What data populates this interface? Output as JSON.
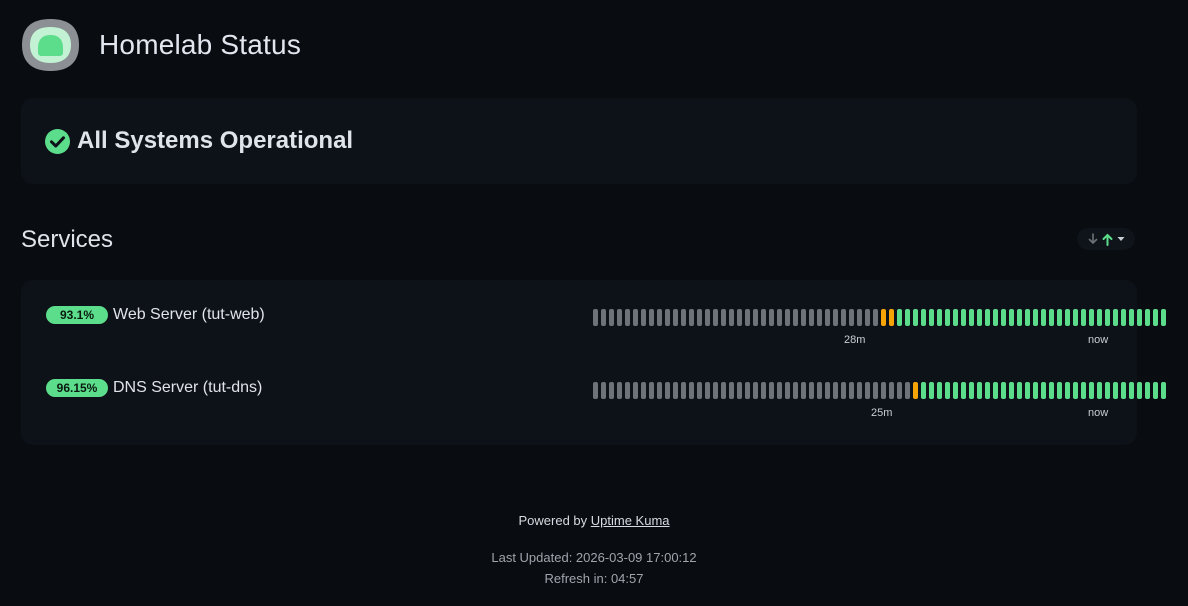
{
  "page": {
    "title": "Homelab Status",
    "logo_icon": "uptime-kuma-logo-icon"
  },
  "overall": {
    "status_text": "All Systems Operational",
    "icon": "check-circle-icon",
    "color": "#5cdd8b"
  },
  "services_section": {
    "title": "Services",
    "sort_icons": [
      "arrow-down-icon",
      "arrow-up-icon",
      "caret-down-icon"
    ]
  },
  "services": [
    {
      "name": "Web Server (tut-web)",
      "uptime": "93.1%",
      "beats": [
        "down",
        "down",
        "down",
        "down",
        "down",
        "down",
        "down",
        "down",
        "down",
        "down",
        "down",
        "down",
        "down",
        "down",
        "down",
        "down",
        "down",
        "down",
        "down",
        "down",
        "down",
        "down",
        "down",
        "down",
        "down",
        "down",
        "down",
        "down",
        "down",
        "down",
        "down",
        "down",
        "down",
        "down",
        "down",
        "down",
        "pending",
        "pending",
        "up",
        "up",
        "up",
        "up",
        "up",
        "up",
        "up",
        "up",
        "up",
        "up",
        "up",
        "up",
        "up",
        "up",
        "up",
        "up",
        "up",
        "up",
        "up",
        "up",
        "up",
        "up",
        "up",
        "up",
        "up",
        "up",
        "up",
        "up",
        "up",
        "up",
        "up",
        "up",
        "up",
        "up"
      ],
      "since_label": "28m",
      "now_label": "now"
    },
    {
      "name": "DNS Server (tut-dns)",
      "uptime": "96.15%",
      "beats": [
        "down",
        "down",
        "down",
        "down",
        "down",
        "down",
        "down",
        "down",
        "down",
        "down",
        "down",
        "down",
        "down",
        "down",
        "down",
        "down",
        "down",
        "down",
        "down",
        "down",
        "down",
        "down",
        "down",
        "down",
        "down",
        "down",
        "down",
        "down",
        "down",
        "down",
        "down",
        "down",
        "down",
        "down",
        "down",
        "down",
        "down",
        "down",
        "down",
        "down",
        "pending",
        "up",
        "up",
        "up",
        "up",
        "up",
        "up",
        "up",
        "up",
        "up",
        "up",
        "up",
        "up",
        "up",
        "up",
        "up",
        "up",
        "up",
        "up",
        "up",
        "up",
        "up",
        "up",
        "up",
        "up",
        "up",
        "up",
        "up",
        "up",
        "up",
        "up",
        "up"
      ],
      "since_label": "25m",
      "now_label": "now"
    }
  ],
  "footer": {
    "powered_prefix": "Powered by",
    "powered_link": "Uptime Kuma",
    "last_updated": "Last Updated: 2026-03-09 17:00:12",
    "refresh": "Refresh in: 04:57"
  },
  "colors": {
    "up": "#5cdd8b",
    "pending": "#f8a306",
    "down": "#6e7279",
    "background": "#090c10",
    "card": "#0d1118"
  }
}
